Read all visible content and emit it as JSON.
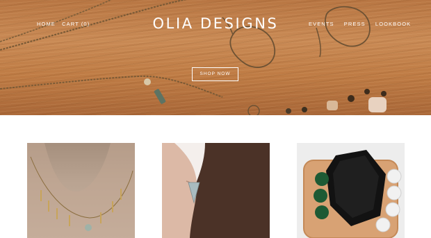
{
  "site": {
    "logo": "OLIA DESIGNS"
  },
  "nav": {
    "left": [
      {
        "label": "HOME"
      },
      {
        "label": "CART (0)"
      }
    ],
    "right": [
      {
        "label": "EVENTS"
      },
      {
        "label": "PRESS"
      },
      {
        "label": "LOOKBOOK"
      }
    ]
  },
  "hero": {
    "cta_label": "SHOP NOW"
  },
  "colors": {
    "wood": "#c08048",
    "text_on_hero": "#ffffff",
    "page_bg": "#ffffff"
  },
  "products": [
    {
      "name": "gold-bar-charm-necklace"
    },
    {
      "name": "triangle-stud-earring"
    },
    {
      "name": "black-stone-cuff-bracelet"
    }
  ]
}
